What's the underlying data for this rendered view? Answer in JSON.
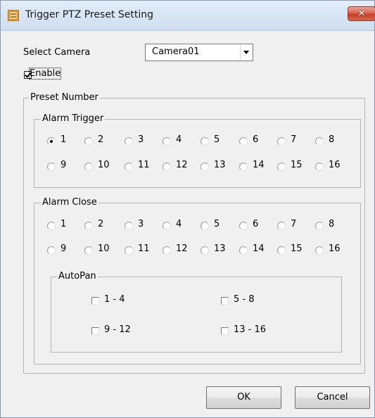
{
  "window": {
    "title": "Trigger PTZ Preset Setting",
    "close_symbol": "✕"
  },
  "camera": {
    "label": "Select Camera",
    "selected": "Camera01"
  },
  "enable": {
    "label": "Enable",
    "checked": true
  },
  "preset_group": {
    "title": "Preset Number"
  },
  "alarm_trigger": {
    "title": "Alarm Trigger",
    "selected": "1",
    "options": [
      "1",
      "2",
      "3",
      "4",
      "5",
      "6",
      "7",
      "8",
      "9",
      "10",
      "11",
      "12",
      "13",
      "14",
      "15",
      "16"
    ]
  },
  "alarm_close": {
    "title": "Alarm Close",
    "selected": "",
    "options": [
      "1",
      "2",
      "3",
      "4",
      "5",
      "6",
      "7",
      "8",
      "9",
      "10",
      "11",
      "12",
      "13",
      "14",
      "15",
      "16"
    ]
  },
  "autopan": {
    "title": "AutoPan",
    "items": [
      "1 - 4",
      "5 - 8",
      "9 - 12",
      "13 - 16"
    ]
  },
  "buttons": {
    "ok": "OK",
    "cancel": "Cancel"
  },
  "icons": {
    "app": "app-window-icon",
    "dropdown": "chevron-down-icon",
    "close": "close-icon"
  },
  "colors": {
    "dialog_bg": "#f0f0f0",
    "close_button": "#c53c24"
  }
}
